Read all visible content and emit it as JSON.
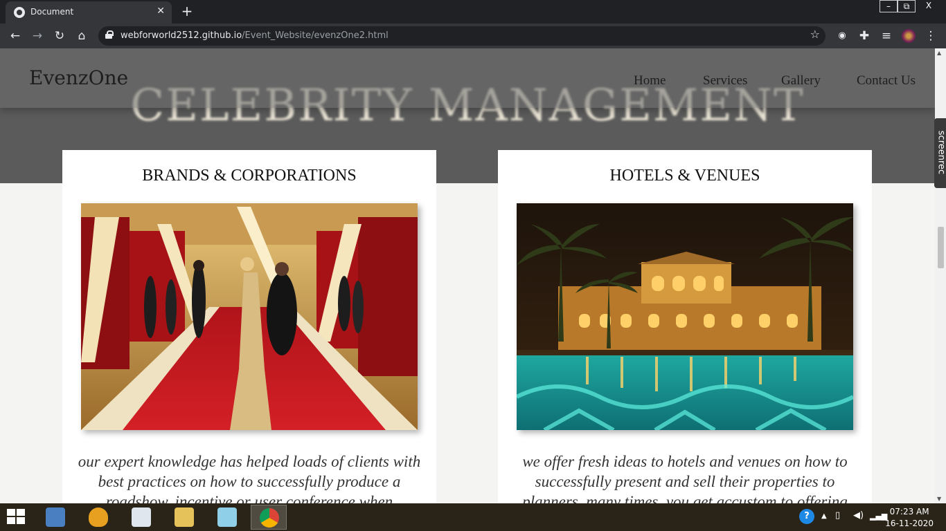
{
  "browser": {
    "tab_title": "Document",
    "new_tab": "+",
    "url_host": "webforworld2512.github.io",
    "url_path": "/Event_Website/evenzOne2.html"
  },
  "window_controls": {
    "minimize": "–",
    "restore": "⧉",
    "close": "X"
  },
  "site": {
    "brand": "EvenzOne",
    "nav": [
      "Home",
      "Services",
      "Gallery",
      "Contact Us"
    ],
    "hero_title": "CELEBRITY MANAGEMENT"
  },
  "cards": [
    {
      "heading": "BRANDS & CORPORATIONS",
      "image_icon": "red-carpet-photo",
      "text": "our expert knowledge has helped loads of clients with best practices on how to successfully produce a roadshow, incentive or user conference when"
    },
    {
      "heading": "HOTELS & VENUES",
      "image_icon": "hotel-pool-photo",
      "text": "we offer fresh ideas to hotels and venues on how to successfully present and sell their properties to planners, many times, you get accustom to offering"
    }
  ],
  "extension_label": "screenrec",
  "taskbar": {
    "time": "07:23 AM",
    "date": "16-11-2020",
    "apps": [
      "remote-desktop-icon",
      "info-shield-icon",
      "presentation-icon",
      "file-explorer-icon",
      "notes-icon",
      "chrome-icon"
    ]
  },
  "colors": {
    "hero_bg": "#5b5b5b",
    "page_bg": "#f4f4f3",
    "chrome_dark": "#202124",
    "chrome_toolbar": "#35363a"
  }
}
